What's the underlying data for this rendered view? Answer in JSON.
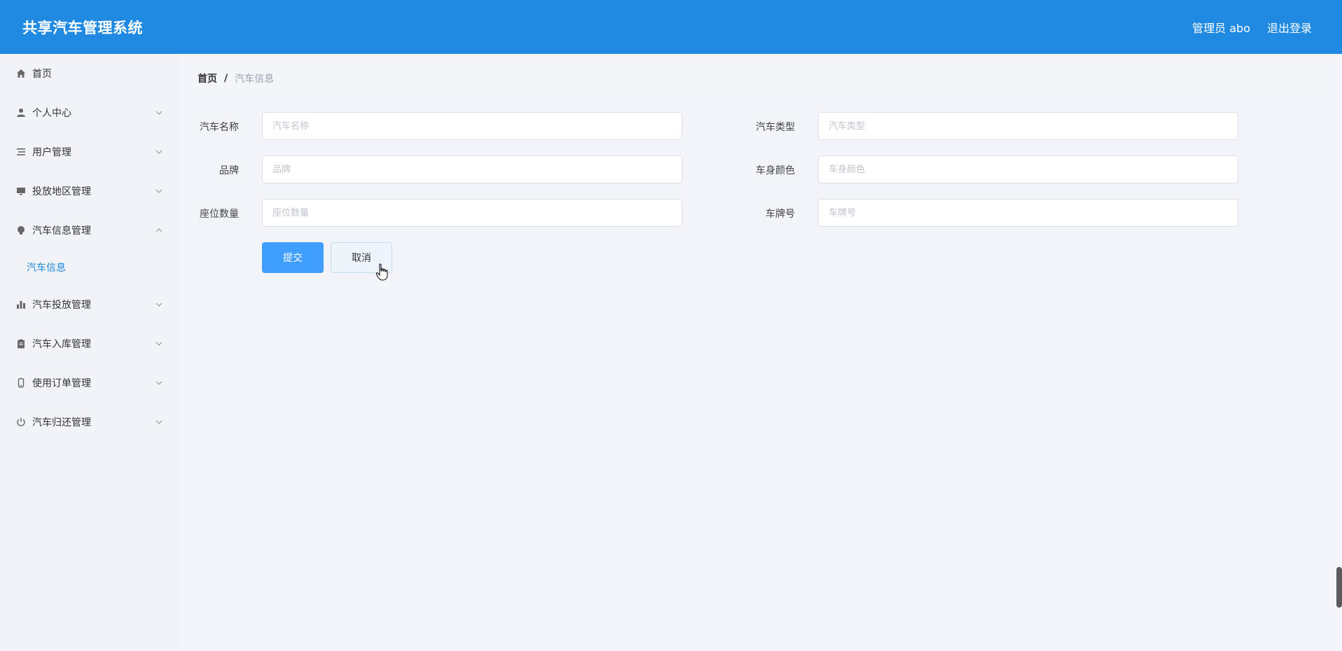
{
  "header": {
    "title": "共享汽车管理系统",
    "user": "管理员 abo",
    "logout": "退出登录"
  },
  "sidebar": {
    "items": [
      {
        "label": "首页",
        "icon": "home-icon",
        "expanded": false
      },
      {
        "label": "个人中心",
        "icon": "user-icon",
        "expanded": false
      },
      {
        "label": "用户管理",
        "icon": "list-icon",
        "expanded": false
      },
      {
        "label": "投放地区管理",
        "icon": "monitor-icon",
        "expanded": false
      },
      {
        "label": "汽车信息管理",
        "icon": "bulb-icon",
        "expanded": true,
        "children": [
          {
            "label": "汽车信息"
          }
        ]
      },
      {
        "label": "汽车投放管理",
        "icon": "bar-chart-icon",
        "expanded": false
      },
      {
        "label": "汽车入库管理",
        "icon": "clipboard-icon",
        "expanded": false
      },
      {
        "label": "使用订单管理",
        "icon": "phone-icon",
        "expanded": false
      },
      {
        "label": "汽车归还管理",
        "icon": "power-icon",
        "expanded": false
      }
    ]
  },
  "breadcrumb": {
    "home": "首页",
    "separator": "/",
    "current": "汽车信息"
  },
  "form": {
    "car_name": {
      "label": "汽车名称",
      "placeholder": "汽车名称",
      "value": ""
    },
    "car_type": {
      "label": "汽车类型",
      "placeholder": "汽车类型",
      "value": ""
    },
    "brand": {
      "label": "品牌",
      "placeholder": "品牌",
      "value": ""
    },
    "body_color": {
      "label": "车身颜色",
      "placeholder": "车身颜色",
      "value": ""
    },
    "seats": {
      "label": "座位数量",
      "placeholder": "座位数量",
      "value": ""
    },
    "plate": {
      "label": "车牌号",
      "placeholder": "车牌号",
      "value": ""
    },
    "submit": "提交",
    "cancel": "取消"
  },
  "colors": {
    "header_bg": "#208ae3",
    "primary": "#409eff",
    "active_sub": "#1e88d9"
  }
}
